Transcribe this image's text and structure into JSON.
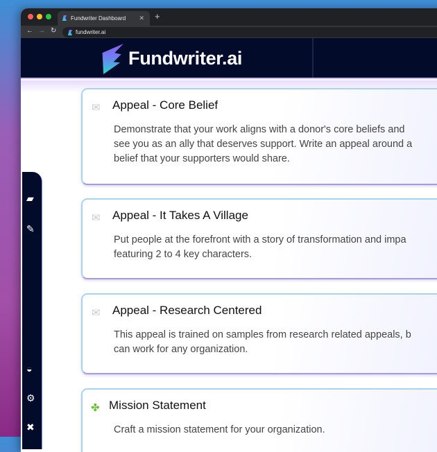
{
  "browser": {
    "tab_title": "Fundwriter Dashboard",
    "url": "fundwriter.ai"
  },
  "header": {
    "logo_text": "Fundwriter.ai"
  },
  "sidebar": {
    "icons": [
      "folder-open-icon",
      "pencil-icon",
      "dashboard-icon",
      "gears-icon",
      "close-icon"
    ]
  },
  "cards": [
    {
      "icon": "envelope-icon",
      "title": "Appeal - Core Belief",
      "lines": [
        "Demonstrate that your work aligns with a donor's core beliefs and",
        "see you as an ally that deserves support. Write an appeal around a",
        "belief that your supporters would share."
      ]
    },
    {
      "icon": "envelope-icon",
      "title": "Appeal - It Takes A Village",
      "lines": [
        "Put people at the forefront with a story of transformation and impa",
        "featuring 2 to 4 key characters."
      ]
    },
    {
      "icon": "envelope-icon",
      "title": "Appeal - Research Centered",
      "lines": [
        "This appeal is trained on samples from research related appeals, b",
        "can work for any organization."
      ]
    },
    {
      "icon": "puzzle-icon",
      "title": "Mission Statement",
      "lines": [
        "Craft a mission statement for your organization."
      ]
    }
  ]
}
